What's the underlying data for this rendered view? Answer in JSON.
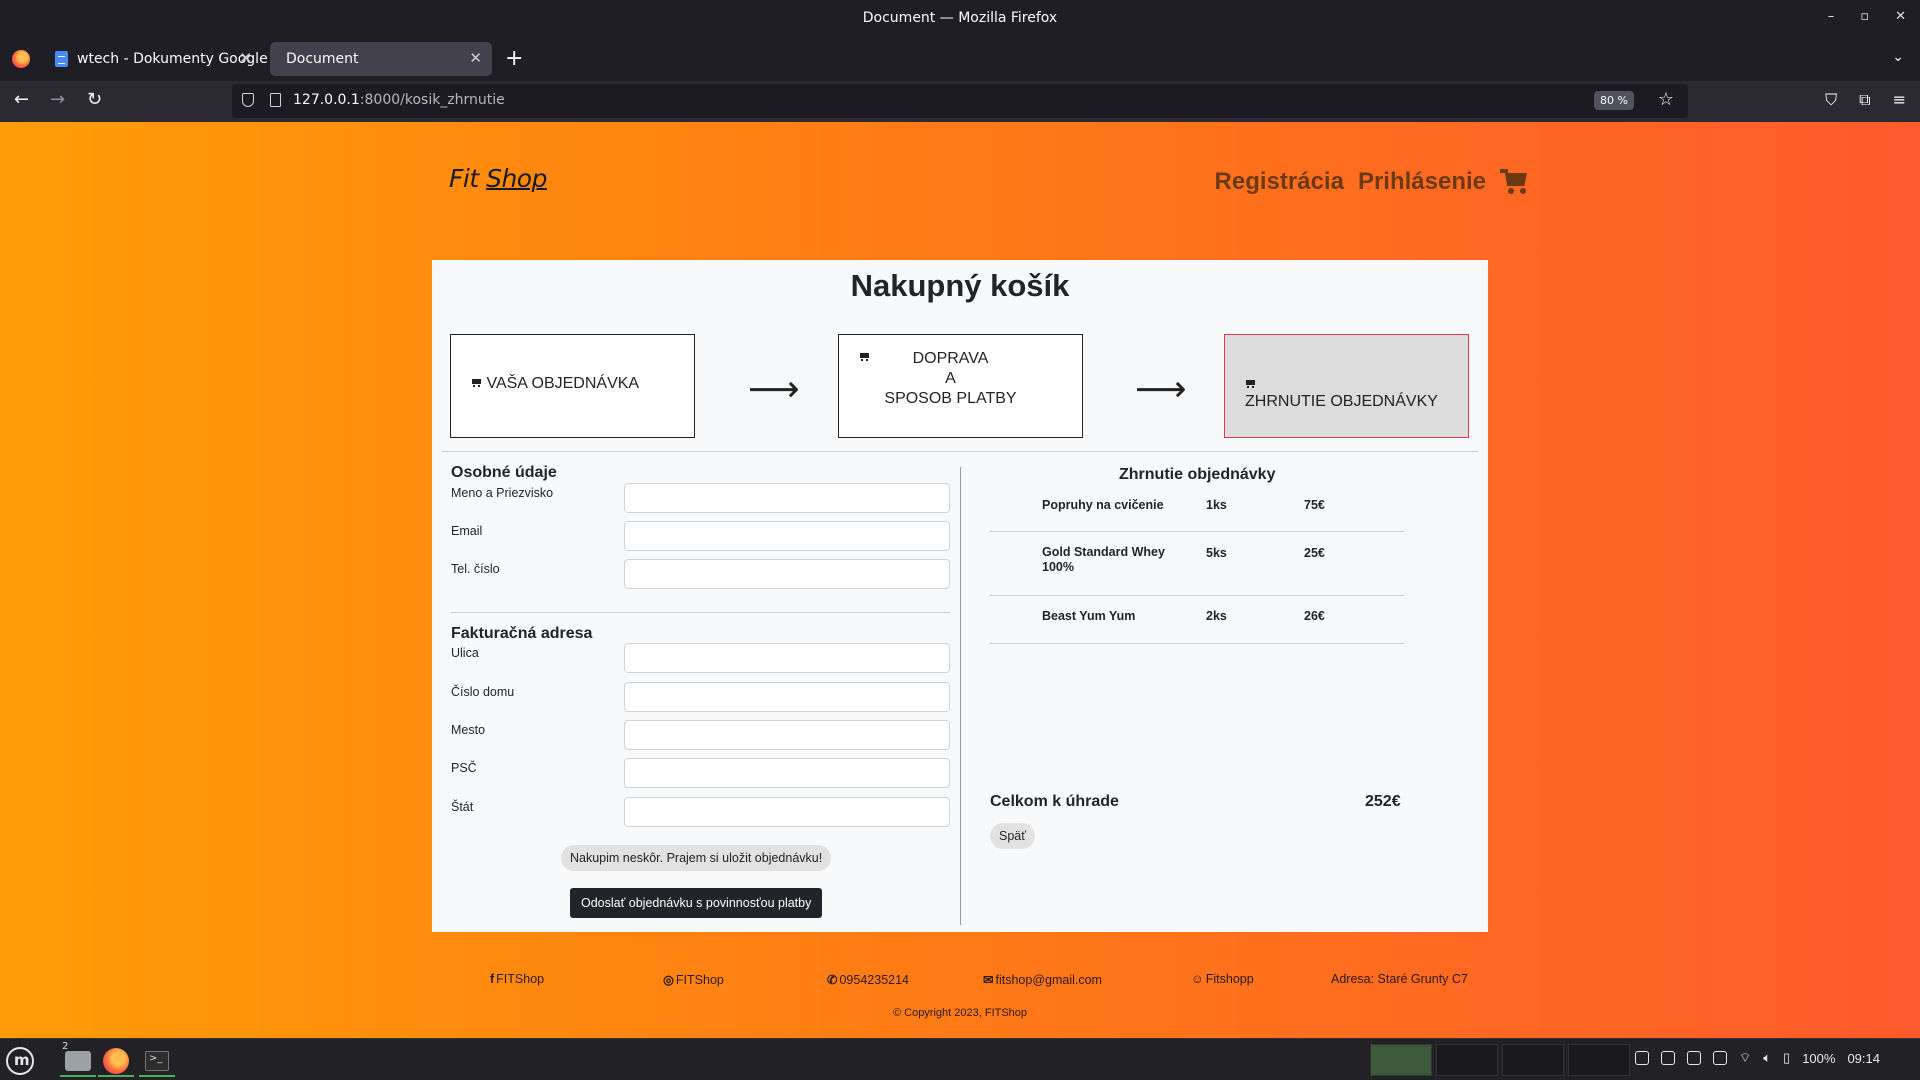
{
  "window": {
    "title": "Document — Mozilla Firefox"
  },
  "tabs": [
    {
      "label": "wtech - Dokumenty Google"
    },
    {
      "label": "Document"
    }
  ],
  "urlbar": {
    "host": "127.0.0.1",
    "path": ":8000/kosik_zhrnutie",
    "zoom": "80 %"
  },
  "site": {
    "logo_fit": "Fit",
    "logo_shop": "Shop",
    "nav": {
      "register": "Registrácia",
      "login": "Prihlásenie"
    }
  },
  "page": {
    "title": "Nakupný košík",
    "steps": {
      "step1": "VAŠA OBJEDNÁVKA",
      "step2_line1": "DOPRAVA",
      "step2_line2": "A",
      "step2_line3": "SPOSOB PLATBY",
      "step3": "ZHRNUTIE OBJEDNÁVKY"
    },
    "arrow": "⟶"
  },
  "form": {
    "personal_title": "Osobné údaje",
    "name_label": "Meno a Priezvisko",
    "email_label": "Email",
    "phone_label": "Tel. číslo",
    "address_title": "Fakturačná adresa",
    "street_label": "Ulica",
    "house_label": "Číslo domu",
    "city_label": "Mesto",
    "zip_label": "PSČ",
    "country_label": "Štát",
    "save_button": "Nakupim neskôr. Prajem si uložit objednávku!",
    "send_button": "Odoslať objednávku s povinnosťou platby"
  },
  "summary": {
    "title": "Zhrnutie objednávky",
    "items": [
      {
        "name": "Popruhy na cvičenie",
        "qty": "1ks",
        "price": "75€"
      },
      {
        "name": "Gold Standard Whey 100%",
        "qty": "5ks",
        "price": "25€"
      },
      {
        "name": "Beast Yum Yum",
        "qty": "2ks",
        "price": "26€"
      }
    ],
    "total_label": "Celkom k úhrade",
    "total_value": "252€",
    "back_button": "Späť"
  },
  "footer": {
    "facebook": "FITShop",
    "instagram": "FITShop",
    "phone": "0954235214",
    "email": "fitshop@gmail.com",
    "snapchat": "Fitshopp",
    "address": "Adresa: Staré Grunty C7",
    "copyright": "© Copyright 2023, FITShop"
  },
  "taskbar": {
    "files_badge": "2",
    "battery": "100%",
    "time": "09:14"
  },
  "colors": {
    "gradient_start": "#ff9c07",
    "gradient_end": "#ff5a2c",
    "nav_link": "#6b3a14",
    "active_step_border": "#e03a4a"
  }
}
